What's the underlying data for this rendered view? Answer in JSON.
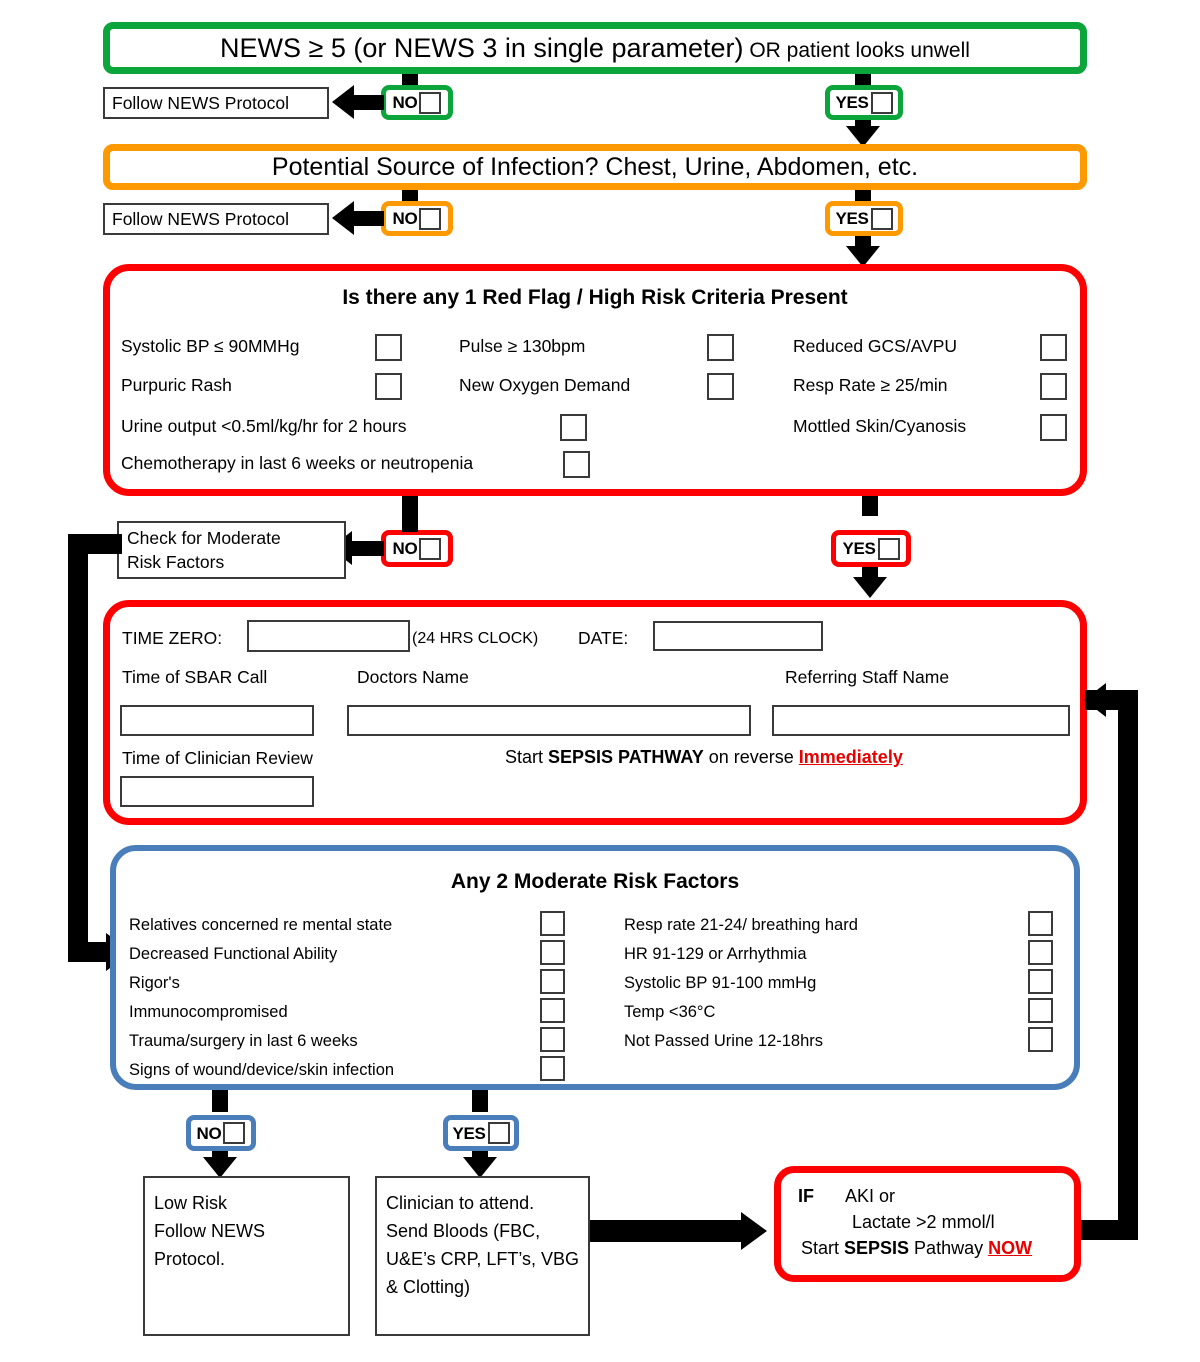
{
  "colors": {
    "green": "#0BA53B",
    "orange": "#FF9900",
    "red": "#FF0000",
    "blue": "#4A7EBB",
    "black": "#000000",
    "accent_red_text": "#E60000"
  },
  "step1": {
    "question_main": "NEWS ≥ 5 (or NEWS 3 in single parameter)",
    "question_tail": " OR patient looks unwell",
    "no_label": "NO",
    "yes_label": "YES",
    "no_outcome": "Follow NEWS Protocol"
  },
  "step2": {
    "question": "Potential Source of Infection? Chest, Urine, Abdomen, etc.",
    "no_label": "NO",
    "yes_label": "YES",
    "no_outcome": "Follow NEWS Protocol"
  },
  "red_flags": {
    "heading": "Is there any 1 Red Flag / High Risk Criteria Present",
    "col1": [
      "Systolic BP ≤ 90MMHg",
      "Purpuric Rash"
    ],
    "col2": [
      "Pulse ≥ 130bpm",
      "New Oxygen Demand"
    ],
    "col3": [
      "Reduced GCS/AVPU",
      "Resp Rate ≥ 25/min",
      "Mottled Skin/Cyanosis"
    ],
    "wide1": "Urine output <0.5ml/kg/hr for 2 hours",
    "wide2": "Chemotherapy in last 6 weeks or neutropenia",
    "no_label": "NO",
    "yes_label": "YES",
    "no_outcome_line1": "Check for Moderate",
    "no_outcome_line2": "Risk Factors"
  },
  "time_zero": {
    "time_zero_label": "TIME ZERO:",
    "time_zero_value": "",
    "clock_note": "(24 HRS CLOCK)",
    "date_label": "DATE:",
    "date_value": "",
    "sbar_label": "Time of SBAR Call",
    "sbar_value": "",
    "doctor_label": "Doctors Name",
    "doctor_value": "",
    "referrer_label": "Referring Staff Name",
    "referrer_value": "",
    "clinician_review_label": "Time of Clinician Review",
    "clinician_review_value": "",
    "action_prefix": "Start ",
    "action_bold": "SEPSIS PATHWAY",
    "action_mid": " on reverse ",
    "action_emph": "Immediately"
  },
  "moderate": {
    "heading": "Any 2 Moderate Risk Factors",
    "left": [
      "Relatives concerned re mental state",
      "Decreased Functional Ability",
      "Rigor's",
      "Immunocompromised",
      "Trauma/surgery in last 6 weeks",
      "Signs of wound/device/skin infection"
    ],
    "right": [
      "Resp rate 21-24/ breathing hard",
      "HR 91-129 or Arrhythmia",
      "Systolic BP 91-100 mmHg",
      "Temp <36°C",
      "Not Passed Urine 12-18hrs"
    ],
    "no_label": "NO",
    "yes_label": "YES"
  },
  "outcomes": {
    "low_risk": [
      "Low Risk",
      "Follow NEWS",
      "Protocol."
    ],
    "clinician": [
      "Clinician to attend.",
      "Send Bloods (FBC,",
      "U&E’s CRP, LFT’s, VBG",
      "& Clotting)"
    ],
    "escalate": {
      "if_label": "IF",
      "line1": "AKI or",
      "line2": "Lactate >2 mmol/l",
      "line3_prefix": "Start ",
      "line3_bold": "SEPSIS",
      "line3_mid": " Pathway ",
      "line3_emph": "NOW"
    }
  }
}
